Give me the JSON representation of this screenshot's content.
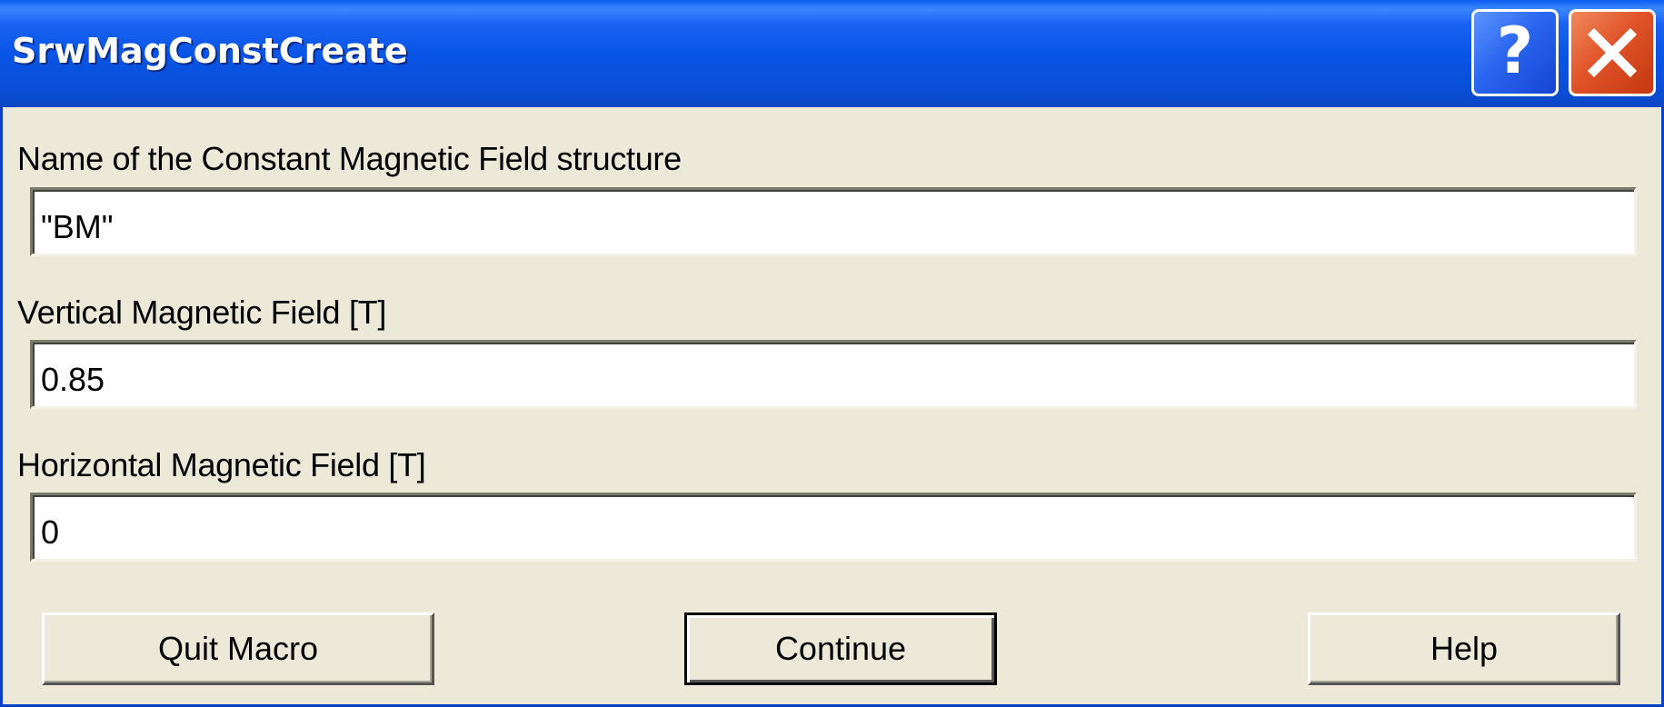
{
  "window": {
    "title": "SrwMagConstCreate"
  },
  "titlebar_buttons": {
    "help_label": "?",
    "help_icon": "question-mark-icon",
    "close_icon": "close-x-icon"
  },
  "fields": [
    {
      "label": "Name of the Constant Magnetic Field structure",
      "value": "\"BM\""
    },
    {
      "label": "Vertical Magnetic Field [T]",
      "value": "0.85"
    },
    {
      "label": "Horizontal Magnetic Field [T]",
      "value": "0"
    }
  ],
  "buttons": {
    "quit_label": "Quit Macro",
    "continue_label": "Continue",
    "help_label": "Help"
  },
  "colors": {
    "titlebar": "#0a55e6",
    "dialog_bg": "#ece9d8",
    "close_button": "#e1542a",
    "help_button": "#2a66f0"
  }
}
